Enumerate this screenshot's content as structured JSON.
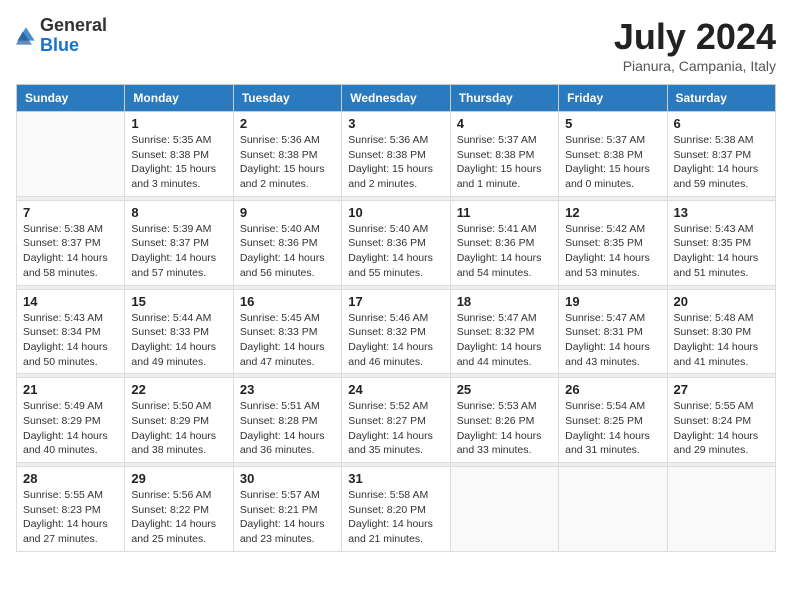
{
  "header": {
    "logo_general": "General",
    "logo_blue": "Blue",
    "month_year": "July 2024",
    "location": "Pianura, Campania, Italy"
  },
  "days_of_week": [
    "Sunday",
    "Monday",
    "Tuesday",
    "Wednesday",
    "Thursday",
    "Friday",
    "Saturday"
  ],
  "weeks": [
    [
      {
        "num": "",
        "sunrise": "",
        "sunset": "",
        "daylight": ""
      },
      {
        "num": "1",
        "sunrise": "Sunrise: 5:35 AM",
        "sunset": "Sunset: 8:38 PM",
        "daylight": "Daylight: 15 hours and 3 minutes."
      },
      {
        "num": "2",
        "sunrise": "Sunrise: 5:36 AM",
        "sunset": "Sunset: 8:38 PM",
        "daylight": "Daylight: 15 hours and 2 minutes."
      },
      {
        "num": "3",
        "sunrise": "Sunrise: 5:36 AM",
        "sunset": "Sunset: 8:38 PM",
        "daylight": "Daylight: 15 hours and 2 minutes."
      },
      {
        "num": "4",
        "sunrise": "Sunrise: 5:37 AM",
        "sunset": "Sunset: 8:38 PM",
        "daylight": "Daylight: 15 hours and 1 minute."
      },
      {
        "num": "5",
        "sunrise": "Sunrise: 5:37 AM",
        "sunset": "Sunset: 8:38 PM",
        "daylight": "Daylight: 15 hours and 0 minutes."
      },
      {
        "num": "6",
        "sunrise": "Sunrise: 5:38 AM",
        "sunset": "Sunset: 8:37 PM",
        "daylight": "Daylight: 14 hours and 59 minutes."
      }
    ],
    [
      {
        "num": "7",
        "sunrise": "Sunrise: 5:38 AM",
        "sunset": "Sunset: 8:37 PM",
        "daylight": "Daylight: 14 hours and 58 minutes."
      },
      {
        "num": "8",
        "sunrise": "Sunrise: 5:39 AM",
        "sunset": "Sunset: 8:37 PM",
        "daylight": "Daylight: 14 hours and 57 minutes."
      },
      {
        "num": "9",
        "sunrise": "Sunrise: 5:40 AM",
        "sunset": "Sunset: 8:36 PM",
        "daylight": "Daylight: 14 hours and 56 minutes."
      },
      {
        "num": "10",
        "sunrise": "Sunrise: 5:40 AM",
        "sunset": "Sunset: 8:36 PM",
        "daylight": "Daylight: 14 hours and 55 minutes."
      },
      {
        "num": "11",
        "sunrise": "Sunrise: 5:41 AM",
        "sunset": "Sunset: 8:36 PM",
        "daylight": "Daylight: 14 hours and 54 minutes."
      },
      {
        "num": "12",
        "sunrise": "Sunrise: 5:42 AM",
        "sunset": "Sunset: 8:35 PM",
        "daylight": "Daylight: 14 hours and 53 minutes."
      },
      {
        "num": "13",
        "sunrise": "Sunrise: 5:43 AM",
        "sunset": "Sunset: 8:35 PM",
        "daylight": "Daylight: 14 hours and 51 minutes."
      }
    ],
    [
      {
        "num": "14",
        "sunrise": "Sunrise: 5:43 AM",
        "sunset": "Sunset: 8:34 PM",
        "daylight": "Daylight: 14 hours and 50 minutes."
      },
      {
        "num": "15",
        "sunrise": "Sunrise: 5:44 AM",
        "sunset": "Sunset: 8:33 PM",
        "daylight": "Daylight: 14 hours and 49 minutes."
      },
      {
        "num": "16",
        "sunrise": "Sunrise: 5:45 AM",
        "sunset": "Sunset: 8:33 PM",
        "daylight": "Daylight: 14 hours and 47 minutes."
      },
      {
        "num": "17",
        "sunrise": "Sunrise: 5:46 AM",
        "sunset": "Sunset: 8:32 PM",
        "daylight": "Daylight: 14 hours and 46 minutes."
      },
      {
        "num": "18",
        "sunrise": "Sunrise: 5:47 AM",
        "sunset": "Sunset: 8:32 PM",
        "daylight": "Daylight: 14 hours and 44 minutes."
      },
      {
        "num": "19",
        "sunrise": "Sunrise: 5:47 AM",
        "sunset": "Sunset: 8:31 PM",
        "daylight": "Daylight: 14 hours and 43 minutes."
      },
      {
        "num": "20",
        "sunrise": "Sunrise: 5:48 AM",
        "sunset": "Sunset: 8:30 PM",
        "daylight": "Daylight: 14 hours and 41 minutes."
      }
    ],
    [
      {
        "num": "21",
        "sunrise": "Sunrise: 5:49 AM",
        "sunset": "Sunset: 8:29 PM",
        "daylight": "Daylight: 14 hours and 40 minutes."
      },
      {
        "num": "22",
        "sunrise": "Sunrise: 5:50 AM",
        "sunset": "Sunset: 8:29 PM",
        "daylight": "Daylight: 14 hours and 38 minutes."
      },
      {
        "num": "23",
        "sunrise": "Sunrise: 5:51 AM",
        "sunset": "Sunset: 8:28 PM",
        "daylight": "Daylight: 14 hours and 36 minutes."
      },
      {
        "num": "24",
        "sunrise": "Sunrise: 5:52 AM",
        "sunset": "Sunset: 8:27 PM",
        "daylight": "Daylight: 14 hours and 35 minutes."
      },
      {
        "num": "25",
        "sunrise": "Sunrise: 5:53 AM",
        "sunset": "Sunset: 8:26 PM",
        "daylight": "Daylight: 14 hours and 33 minutes."
      },
      {
        "num": "26",
        "sunrise": "Sunrise: 5:54 AM",
        "sunset": "Sunset: 8:25 PM",
        "daylight": "Daylight: 14 hours and 31 minutes."
      },
      {
        "num": "27",
        "sunrise": "Sunrise: 5:55 AM",
        "sunset": "Sunset: 8:24 PM",
        "daylight": "Daylight: 14 hours and 29 minutes."
      }
    ],
    [
      {
        "num": "28",
        "sunrise": "Sunrise: 5:55 AM",
        "sunset": "Sunset: 8:23 PM",
        "daylight": "Daylight: 14 hours and 27 minutes."
      },
      {
        "num": "29",
        "sunrise": "Sunrise: 5:56 AM",
        "sunset": "Sunset: 8:22 PM",
        "daylight": "Daylight: 14 hours and 25 minutes."
      },
      {
        "num": "30",
        "sunrise": "Sunrise: 5:57 AM",
        "sunset": "Sunset: 8:21 PM",
        "daylight": "Daylight: 14 hours and 23 minutes."
      },
      {
        "num": "31",
        "sunrise": "Sunrise: 5:58 AM",
        "sunset": "Sunset: 8:20 PM",
        "daylight": "Daylight: 14 hours and 21 minutes."
      },
      {
        "num": "",
        "sunrise": "",
        "sunset": "",
        "daylight": ""
      },
      {
        "num": "",
        "sunrise": "",
        "sunset": "",
        "daylight": ""
      },
      {
        "num": "",
        "sunrise": "",
        "sunset": "",
        "daylight": ""
      }
    ]
  ]
}
